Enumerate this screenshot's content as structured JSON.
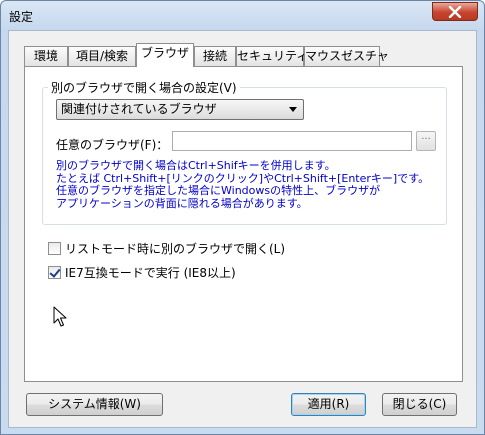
{
  "window": {
    "title": "設定"
  },
  "tabs": [
    {
      "label": "環境"
    },
    {
      "label": "項目/検索"
    },
    {
      "label": "ブラウザ"
    },
    {
      "label": "接続"
    },
    {
      "label": "セキュリティ"
    },
    {
      "label": "マウスゼスチャ"
    }
  ],
  "group": {
    "legend": "別のブラウザで開く場合の設定(V)",
    "select_value": "関連付けされているブラウザ",
    "browser_label": "任意のブラウザ(F)：",
    "browser_value": "",
    "browse_label": "···",
    "notes": [
      "別のブラウザで開く場合はCtrl+Shifキーを併用します。",
      "たとえば Ctrl+Shift+[リンクのクリック]やCtrl+Shift+[Enterキー]です。",
      "任意のブラウザを指定した場合にWindowsの特性上、ブラウザが",
      "アプリケーションの背面に隠れる場合があります。"
    ]
  },
  "options": {
    "list_mode_label": "リストモード時に別のブラウザで開く(L)",
    "list_mode_checked": false,
    "ie7_label": "IE7互換モードで実行 (IE8以上)",
    "ie7_checked": true
  },
  "buttons": {
    "system_info": "システム情報(W)",
    "apply": "適用(R)",
    "close": "閉じる(C)"
  },
  "colors": {
    "note_text": "#0000cc",
    "close_button": "#c8442f"
  }
}
